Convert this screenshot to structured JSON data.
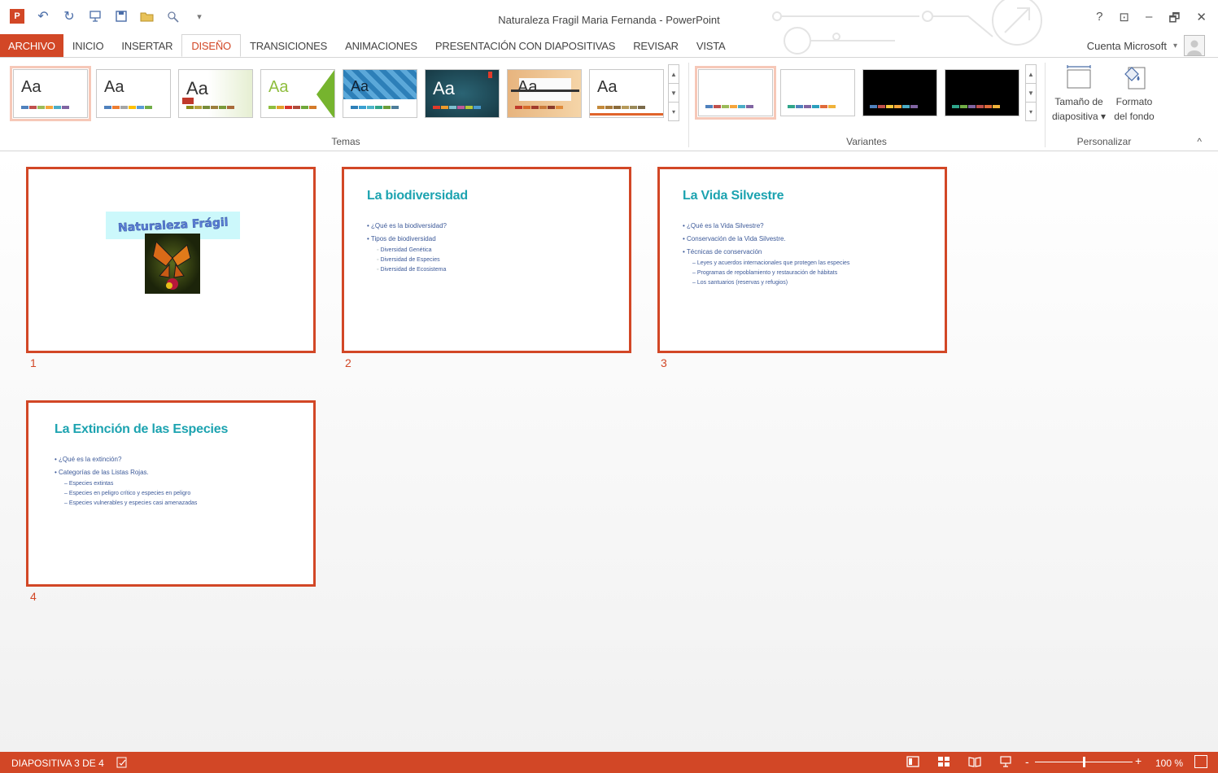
{
  "window": {
    "title": "Naturaleza Fragil Maria Fernanda - PowerPoint",
    "help": "?",
    "ribbon_display": "⊡",
    "minimize": "–",
    "restore": "🗗",
    "close": "✕"
  },
  "quick_access": {
    "app_icon": "P",
    "undo": "↶",
    "redo": "↻",
    "more": "▾"
  },
  "tabs": [
    "ARCHIVO",
    "INICIO",
    "INSERTAR",
    "DISEÑO",
    "TRANSICIONES",
    "ANIMACIONES",
    "PRESENTACIÓN CON DIAPOSITIVAS",
    "REVISAR",
    "VISTA"
  ],
  "active_tab": "DISEÑO",
  "account": {
    "label": "Cuenta Microsoft",
    "caret": "▾"
  },
  "ribbon": {
    "themes_label": "Temas",
    "variants_label": "Variantes",
    "customize_label": "Personalizar",
    "theme_glyphs": [
      "Aa",
      "Aa",
      "Aa",
      "Aa",
      "Aa",
      "Aa",
      "Aa",
      "Aa"
    ],
    "slide_size": {
      "line1": "Tamaño de",
      "line2": "diapositiva ▾"
    },
    "background_format": {
      "line1": "Formato",
      "line2": "del fondo"
    },
    "collapse": "^",
    "scroll_up": "▲",
    "scroll_down": "▼",
    "scroll_more": "▾"
  },
  "slides": [
    {
      "number": "1",
      "title": "Naturaleza Frágil"
    },
    {
      "number": "2",
      "title": "La biodiversidad",
      "bullets": [
        "¿Qué es la biodiversidad?",
        "Tipos de biodiversidad"
      ],
      "sub": [
        "Diversidad Genética",
        "Diversidad de Especies",
        "Diversidad de Ecosistema"
      ]
    },
    {
      "number": "3",
      "title": "La Vida Silvestre",
      "bullets": [
        "¿Qué es la Vida Silvestre?",
        "Conservación de la Vida Silvestre.",
        "Técnicas de conservación"
      ],
      "sub": [
        "Leyes y acuerdos internacionales que protegen las especies",
        "Programas de repoblamiento y restauración de hábitats",
        "Los santuarios (reservas y refugios)"
      ]
    },
    {
      "number": "4",
      "title": "La Extinción de las Especies",
      "bullets": [
        "¿Qué es la extinción?",
        "Categorías de las Listas Rojas."
      ],
      "sub": [
        "Especies extintas",
        "Especies en peligro crítico y especies en peligro",
        "Especies vulnerables y especies casi amenazadas"
      ]
    }
  ],
  "status": {
    "slide_info": "DIAPOSITIVA 3 DE 4",
    "zoom": "100 %",
    "zoom_fraction": 0.5,
    "minus": "-",
    "plus": "+"
  },
  "colors": {
    "accent": "#d24726",
    "title_teal": "#1ca3b0",
    "body_blue": "#3d5a99"
  }
}
